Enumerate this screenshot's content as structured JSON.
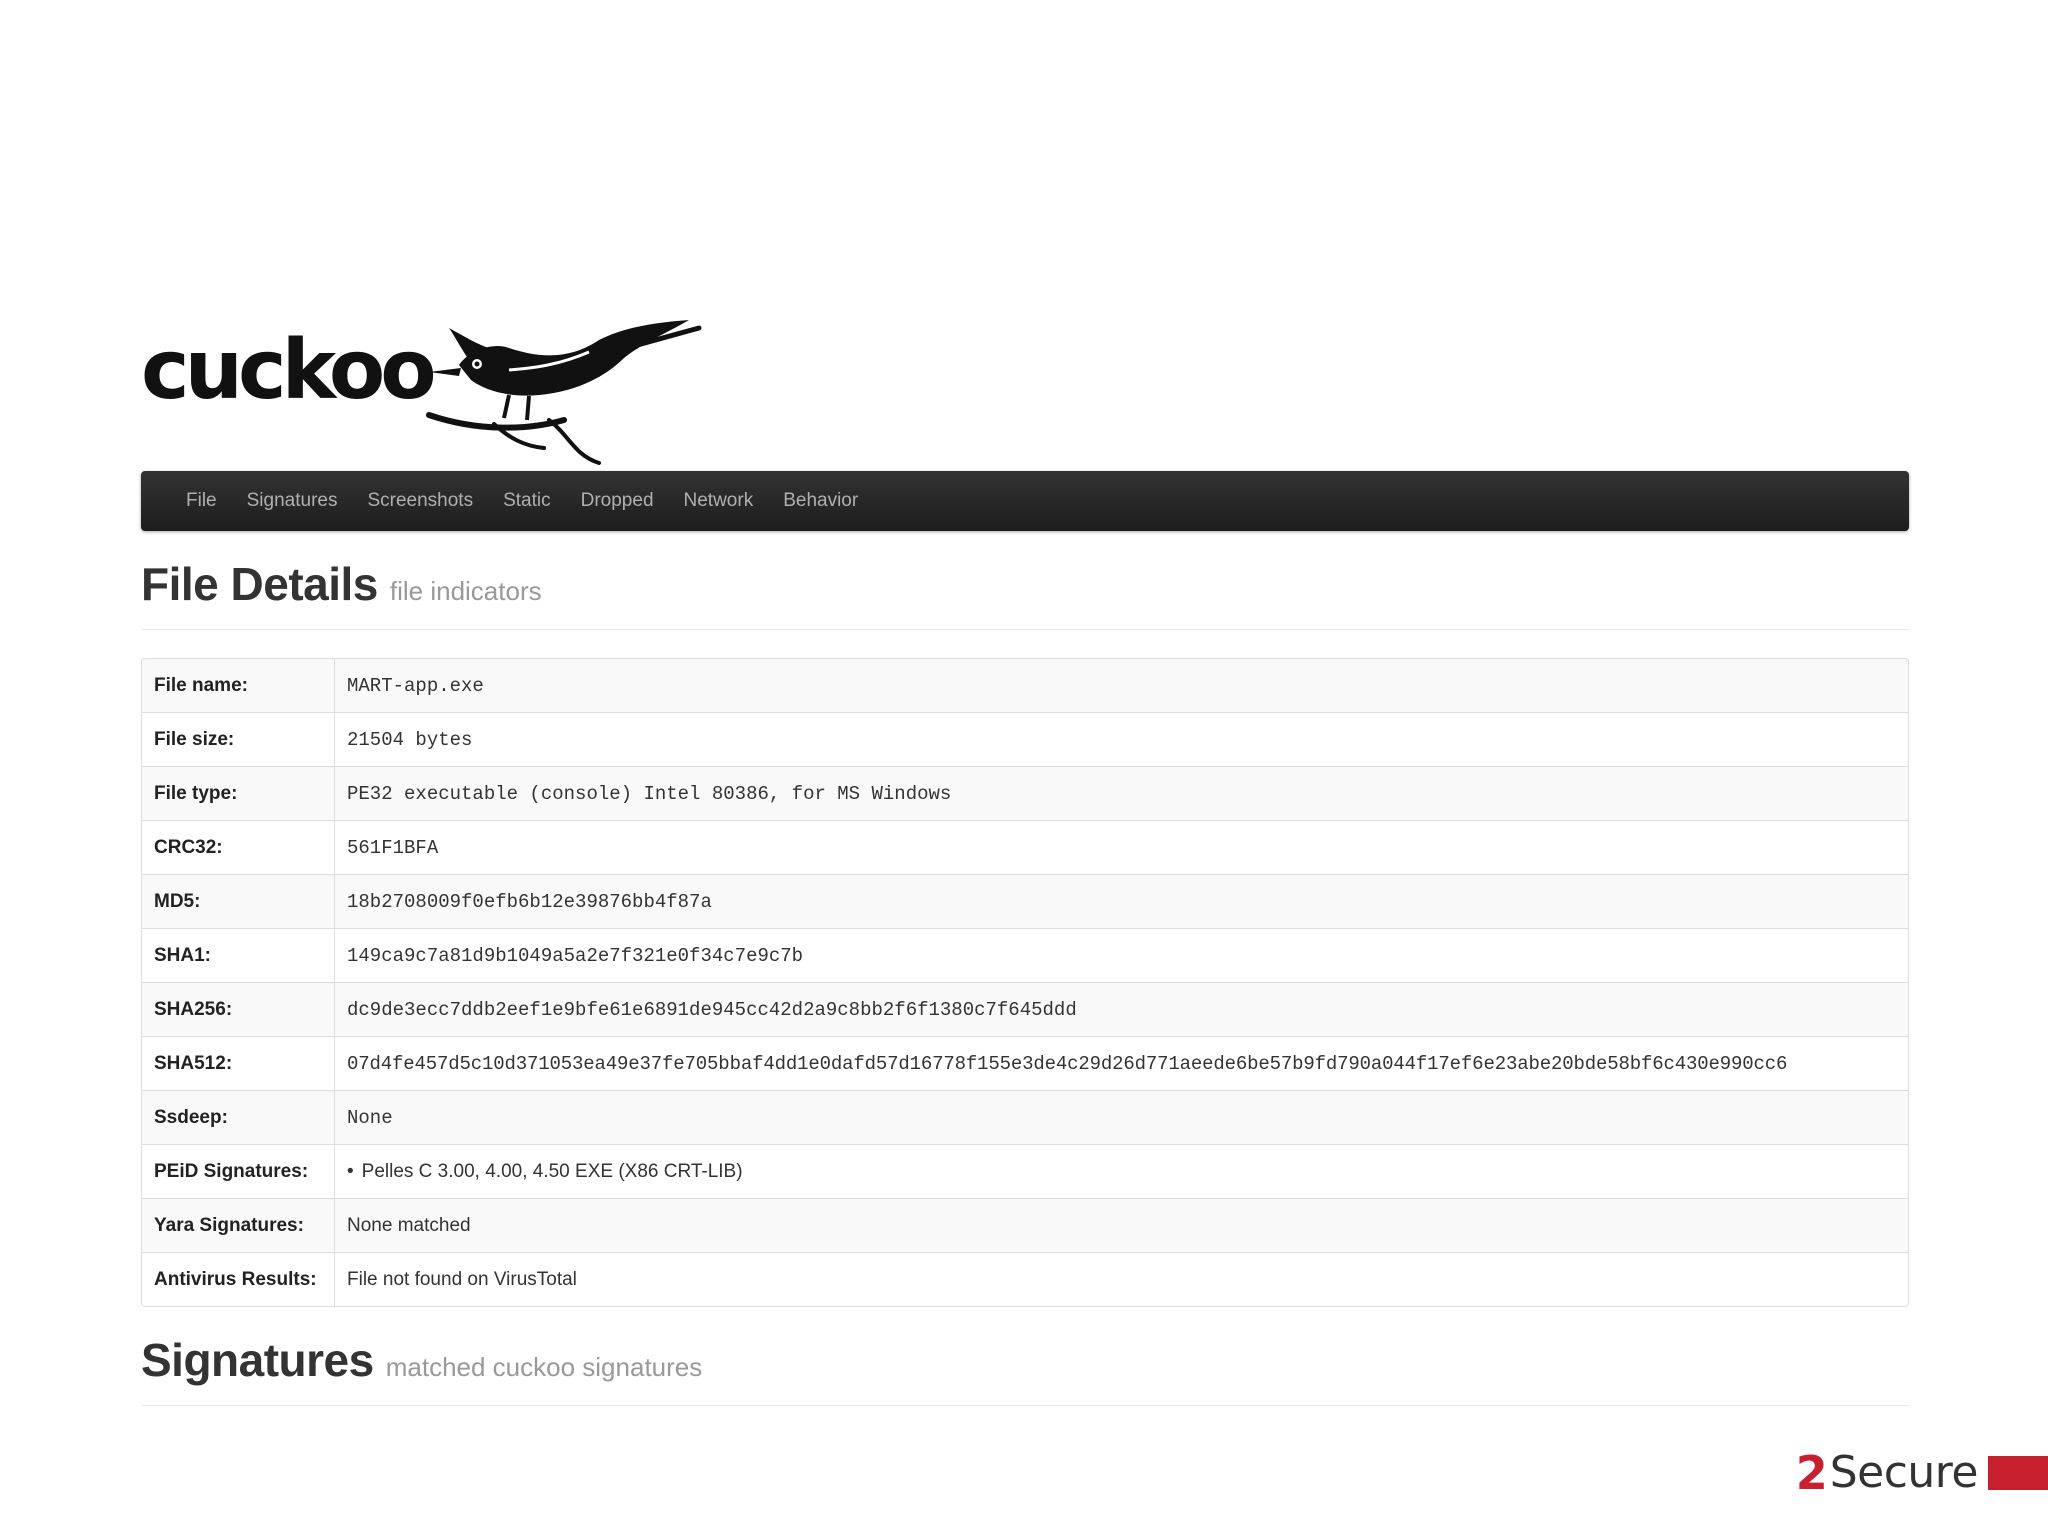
{
  "logo": {
    "text": "cuckoo",
    "icon": "cuckoo-bird-icon"
  },
  "nav": {
    "items": [
      {
        "label": "File"
      },
      {
        "label": "Signatures"
      },
      {
        "label": "Screenshots"
      },
      {
        "label": "Static"
      },
      {
        "label": "Dropped"
      },
      {
        "label": "Network"
      },
      {
        "label": "Behavior"
      }
    ]
  },
  "file_details": {
    "title": "File Details",
    "subtitle": "file indicators",
    "rows": [
      {
        "label": "File name:",
        "value": "MART-app.exe"
      },
      {
        "label": "File size:",
        "value": "21504 bytes"
      },
      {
        "label": "File type:",
        "value": "PE32 executable (console) Intel 80386, for MS Windows"
      },
      {
        "label": "CRC32:",
        "value": "561F1BFA"
      },
      {
        "label": "MD5:",
        "value": "18b2708009f0efb6b12e39876bb4f87a"
      },
      {
        "label": "SHA1:",
        "value": "149ca9c7a81d9b1049a5a2e7f321e0f34c7e9c7b"
      },
      {
        "label": "SHA256:",
        "value": "dc9de3ecc7ddb2eef1e9bfe61e6891de945cc42d2a9c8bb2f6f1380c7f645ddd"
      },
      {
        "label": "SHA512:",
        "value": "07d4fe457d5c10d371053ea49e37fe705bbaf4dd1e0dafd57d16778f155e3de4c29d26d771aeede6be57b9fd790a044f17ef6e23abe20bde58bf6c430e990cc6"
      },
      {
        "label": "Ssdeep:",
        "value": "None"
      },
      {
        "label": "PEiD Signatures:",
        "value": "Pelles C 3.00, 4.00, 4.50 EXE (X86 CRT-LIB)"
      },
      {
        "label": "Yara Signatures:",
        "value": "None matched"
      },
      {
        "label": "Antivirus Results:",
        "value": "File not found on VirusTotal"
      }
    ]
  },
  "signatures": {
    "title": "Signatures",
    "subtitle": "matched cuckoo signatures"
  },
  "brand": {
    "number": "2",
    "text": "Secure",
    "color": "#c8202f"
  }
}
